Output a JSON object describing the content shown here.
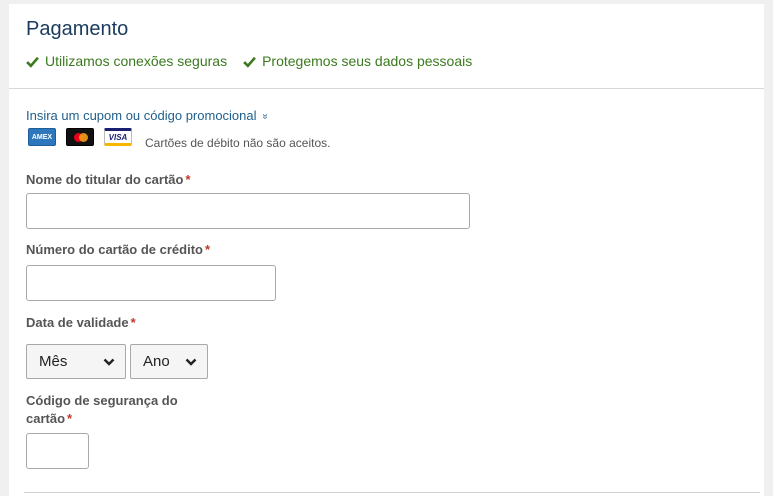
{
  "header": {
    "title": "Pagamento",
    "secure_1": "Utilizamos conexões seguras",
    "secure_2": "Protegemos seus dados pessoais"
  },
  "coupon": {
    "label": "Insira um cupom ou código promocional",
    "chevron": "»"
  },
  "cards": {
    "amex_label": "AMEX",
    "visa_label": "VISA",
    "note": "Cartões de débito não são aceitos."
  },
  "form": {
    "holder_label": "Nome do titular do cartão",
    "holder_value": "",
    "number_label": "Número do cartão de crédito",
    "number_value": "",
    "expiry_label": "Data de validade",
    "month_value": "Mês",
    "year_value": "Ano",
    "cvv_label": "Código de segurança do cartão",
    "cvv_value": "",
    "required_mark": "*"
  },
  "colors": {
    "title": "#1a3b5d",
    "secure_text": "#3b7a1e",
    "link": "#1f5f8b",
    "required": "#c0392b"
  },
  "icons": {
    "check": "check-icon",
    "chevron": "double-chevron-down-icon",
    "select_arrow": "chevron-down-icon"
  }
}
